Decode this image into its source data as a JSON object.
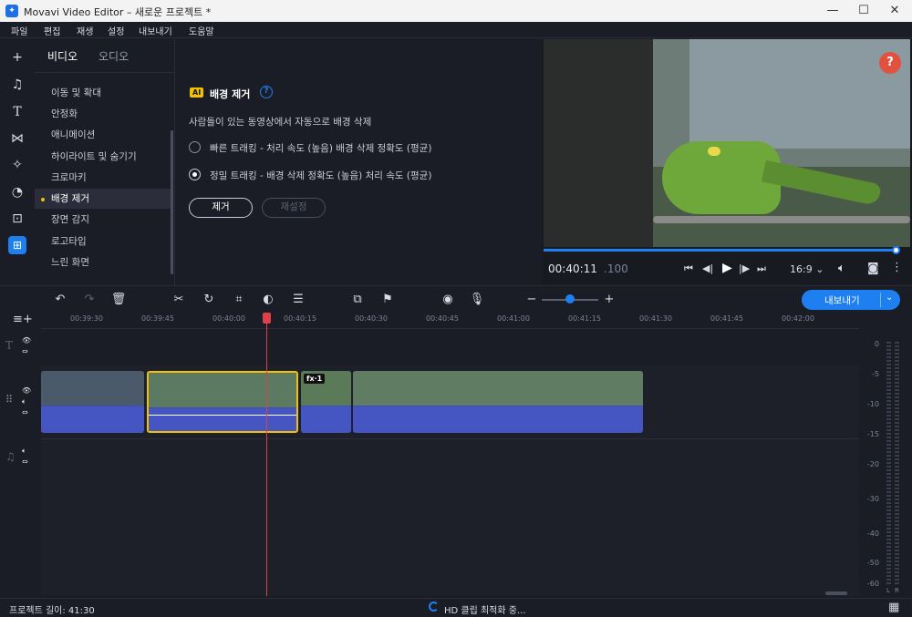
{
  "window": {
    "title": "Movavi Video Editor – 새로운 프로젝트 *",
    "minimize": "—",
    "maximize": "☐",
    "close": "✕"
  },
  "menu": [
    "파일",
    "편집",
    "재생",
    "설정",
    "내보내기",
    "도움말"
  ],
  "tabs": {
    "video": "비디오",
    "audio": "오디오"
  },
  "categories": [
    "이동 및 확대",
    "안정화",
    "애니메이션",
    "하이라이트 및 숨기기",
    "크로마키",
    "배경 제거",
    "장면 감지",
    "로고타입",
    "느린 화면"
  ],
  "options": {
    "ai_badge": "AI",
    "title": "배경 제거",
    "description": "사람들이 있는 동영상에서 자동으로 배경 삭제",
    "fast": "빠른 트래킹 - 처리 속도 (높음) 배경 삭제 정확도 (평균)",
    "precise": "정밀 트래킹 - 배경 삭제 정확도 (높음) 처리 속도 (평균)",
    "remove_button": "제거",
    "reset_button": "재설정"
  },
  "preview": {
    "time_main": "00:40:11",
    "time_frac": ".100",
    "aspect": "16:9 ⌄",
    "help": "?",
    "progress": 0.995
  },
  "toolbar": {
    "export": "내보내기"
  },
  "ruler": [
    "00:39:30",
    "00:39:45",
    "00:40:00",
    "00:40:15",
    "00:40:30",
    "00:40:45",
    "00:41:00",
    "00:41:15",
    "00:41:30",
    "00:41:45",
    "00:42:00"
  ],
  "clip_fx": "fx·1",
  "meter": {
    "labels": [
      "0",
      "-5",
      "-10",
      "-15",
      "-20",
      "-30",
      "-40",
      "-50",
      "-60"
    ],
    "l": "L",
    "r": "R"
  },
  "status": {
    "project_length": "프로젝트 길이: 41:30",
    "optimizing": "HD 클립 최적화 중..."
  },
  "colors": {
    "accent": "#1d7ff0",
    "selection": "#f2c200",
    "playhead": "#e0404a",
    "audio": "#4556c2"
  }
}
